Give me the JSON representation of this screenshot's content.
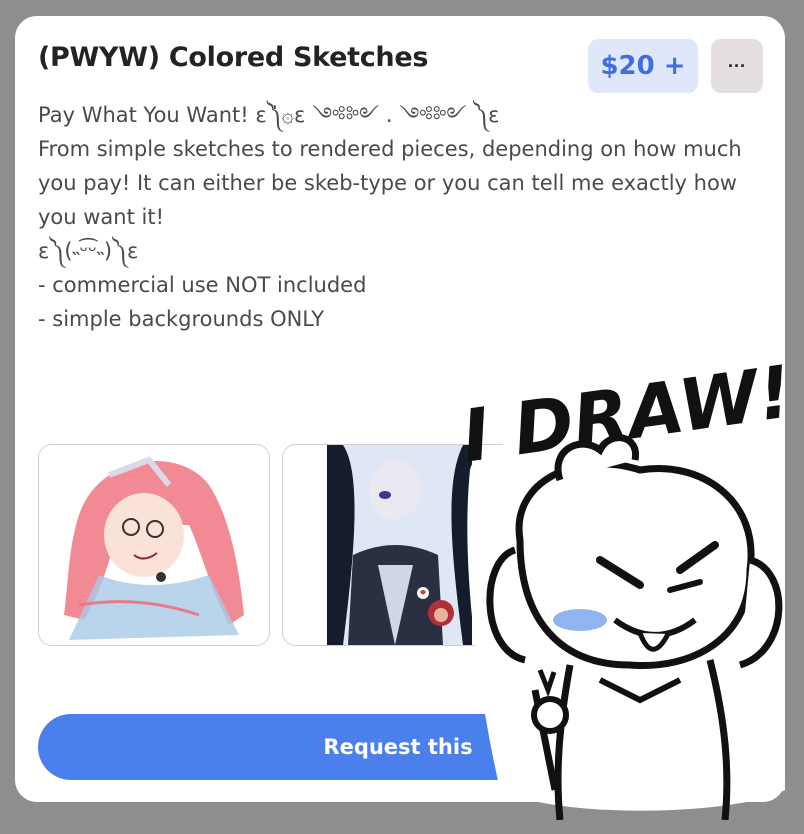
{
  "listing": {
    "title": "(PWYW) Colored Sketches",
    "price": "$20 +",
    "more_label": "···",
    "description_lines": [
      "Pay What You Want! ε༽່۞ε ༺༻ . ༺༻ ༽ε",
      "",
      "From simple sketches to rendered pieces, depending on how much",
      "you pay! It can either be skeb-type or you can tell me exactly how",
      "you want it!",
      "",
      "ε༽(˵ᵕ͡ᵕ˵)༽ε",
      "",
      "- commercial use NOT included",
      "- simple backgrounds ONLY"
    ],
    "request_label": "Request this"
  },
  "sticker": {
    "text": "I DRAW!"
  },
  "colors": {
    "accent": "#4b80ec",
    "price_bg": "#dfe8fb",
    "price_text": "#3e6fe0",
    "backdrop": "#8e8e8e"
  }
}
